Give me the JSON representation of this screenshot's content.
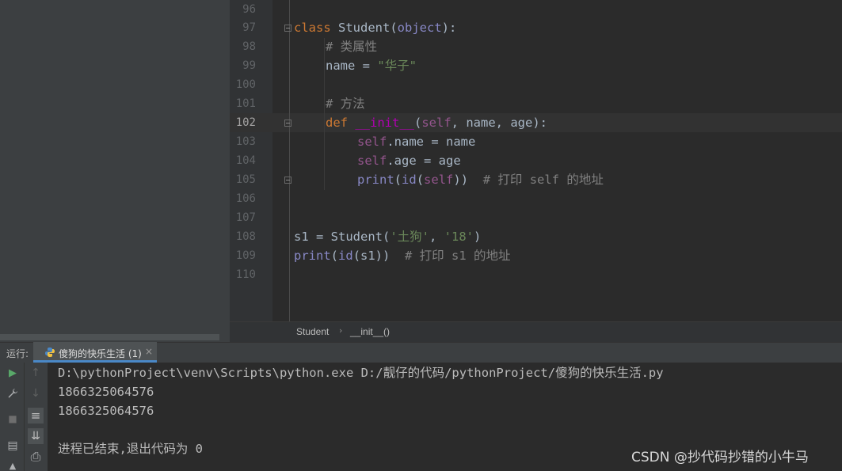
{
  "editor": {
    "line_numbers": [
      "96",
      "97",
      "98",
      "99",
      "100",
      "101",
      "102",
      "103",
      "104",
      "105",
      "106",
      "107",
      "108",
      "109",
      "110"
    ],
    "active_line": "102",
    "code": {
      "l97_kw": "class",
      "l97_name": " Student(",
      "l97_base": "object",
      "l97_end": "):",
      "l98_comment": "# 类属性",
      "l99_name": "name = ",
      "l99_str": "\"华子\"",
      "l101_comment": "# 方法",
      "l102_kw": "def",
      "l102_sp": " ",
      "l102_init": "__init__",
      "l102_open": "(",
      "l102_self": "self",
      "l102_rest": ", name, age):",
      "l103_self": "self",
      "l103_rest": ".name = name",
      "l104_self": "self",
      "l104_rest": ".age = age",
      "l105_print": "print",
      "l105_open": "(",
      "l105_id": "id",
      "l105_open2": "(",
      "l105_self": "self",
      "l105_close": "))",
      "l105_comment": "  # 打印 self 的地址",
      "l108_a": "s1 = Student(",
      "l108_s1": "'土狗'",
      "l108_sep": ", ",
      "l108_s2": "'18'",
      "l108_end": ")",
      "l109_print": "print",
      "l109_open": "(",
      "l109_id": "id",
      "l109_rest": "(s1))",
      "l109_comment": "  # 打印 s1 的地址"
    }
  },
  "breadcrumb": {
    "class": "Student",
    "method": "__init__()"
  },
  "run_panel": {
    "label": "运行:",
    "tab_label": "傻狗的快乐生活 (1)",
    "tab_close": "×",
    "output": [
      "D:\\pythonProject\\venv\\Scripts\\python.exe D:/靓仔的代码/pythonProject/傻狗的快乐生活.py",
      "1866325064576",
      "1866325064576",
      "",
      "进程已结束,退出代码为 0"
    ]
  },
  "toolbar": {
    "run_icon": "▶",
    "wrench_icon": "🔧",
    "stop_icon": "■",
    "layout_icon": "▤",
    "pin_icon": "▲",
    "up_icon": "↑",
    "down_icon": "↓",
    "wrap_icon": "≡",
    "scroll_end_icon": "⇊",
    "print_icon": "⎙"
  },
  "watermark": "CSDN @抄代码抄错的小牛马"
}
